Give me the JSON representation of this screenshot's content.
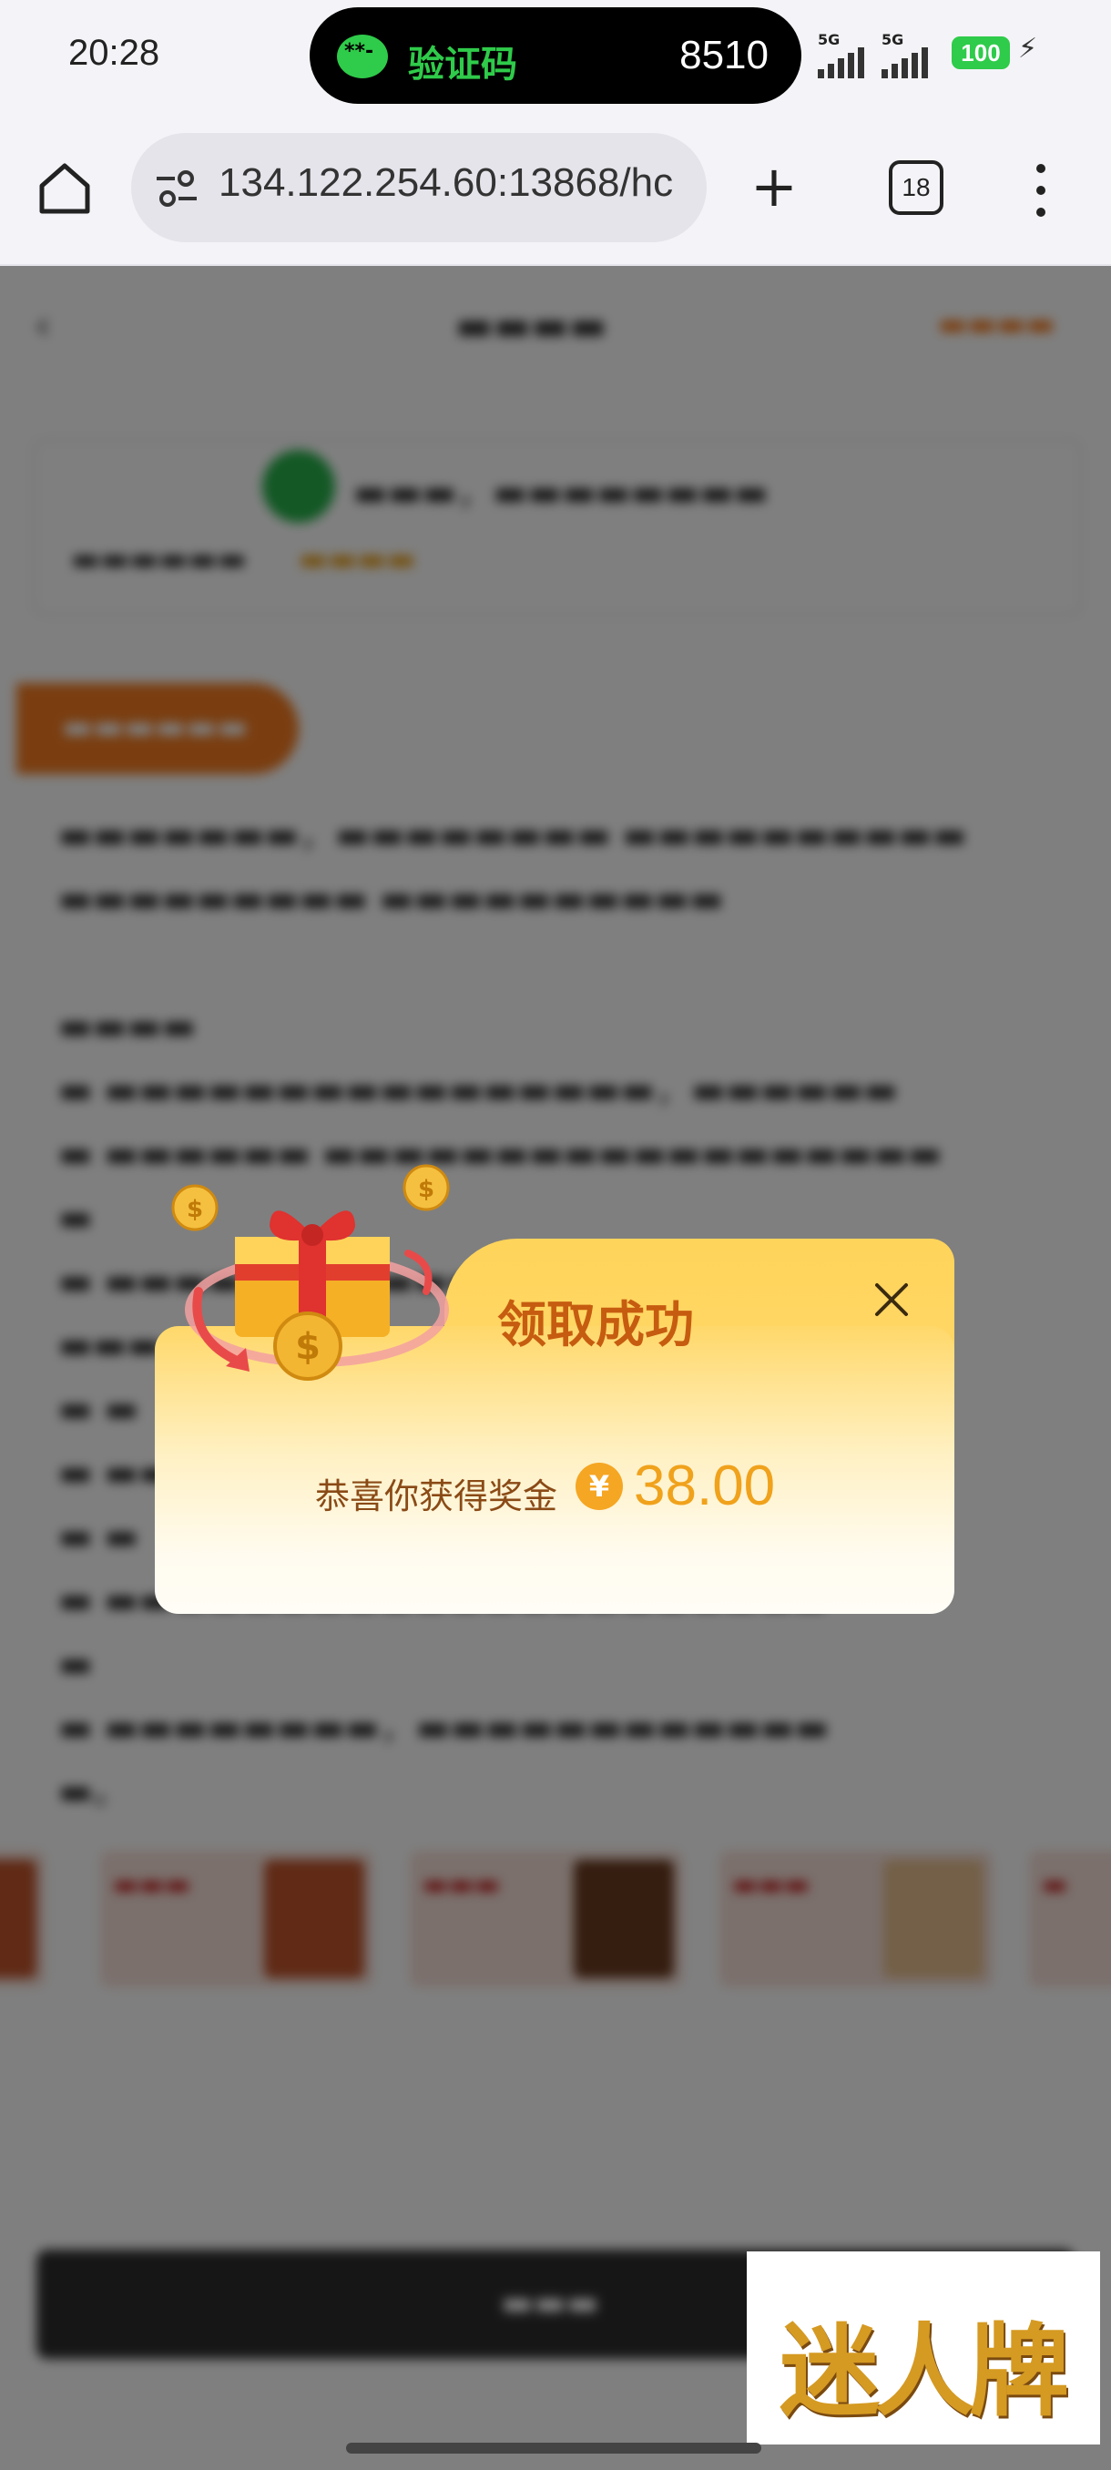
{
  "status_bar": {
    "time": "20:28",
    "notification_label": "验证码",
    "notification_code": "8510",
    "signal_1": "5G",
    "signal_2": "5G",
    "battery": "100"
  },
  "browser": {
    "url": "134.122.254.60:13868/hc",
    "tab_count": "18"
  },
  "dialog": {
    "title": "领取成功",
    "message": "恭喜你获得奖金",
    "currency_symbol": "¥",
    "amount": "38.00"
  },
  "watermark": {
    "text": "迷人牌"
  },
  "colors": {
    "accent_orange": "#f47b20",
    "title_brown": "#c65c10",
    "amount_gold": "#f0a21c",
    "overlay": "rgba(0,0,0,0.5)"
  },
  "icons": [
    "home-icon",
    "site-settings-icon",
    "plus-icon",
    "more-vert-icon",
    "close-icon",
    "gift-box-icon",
    "coin-icon",
    "message-icon"
  ]
}
